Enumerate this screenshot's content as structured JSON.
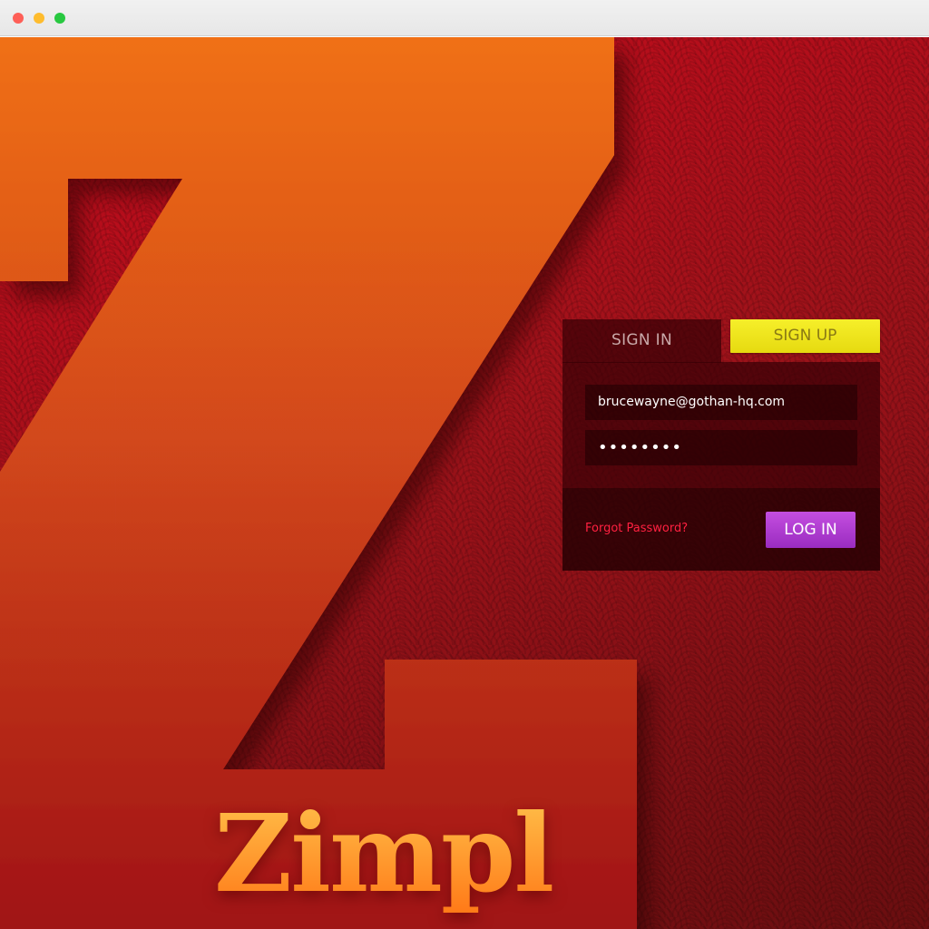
{
  "window": {
    "controls": [
      "close",
      "minimize",
      "zoom"
    ]
  },
  "brand": {
    "logo_letter_icon": "z-letter-icon",
    "name": "Zimpl"
  },
  "login": {
    "tabs": {
      "signin": "SIGN IN",
      "signup": "SIGN UP"
    },
    "email_value": "brucewayne@gothan-hq.com",
    "password_value": "••••••••",
    "forgot_label": "Forgot Password?",
    "login_label": "LOG IN"
  },
  "colors": {
    "background_red": "#c80a1c",
    "logo_orange": "#e8641a",
    "signup_yellow": "#f6ef2a",
    "login_purple": "#b33fd6",
    "forgot_red": "#ff2040"
  }
}
